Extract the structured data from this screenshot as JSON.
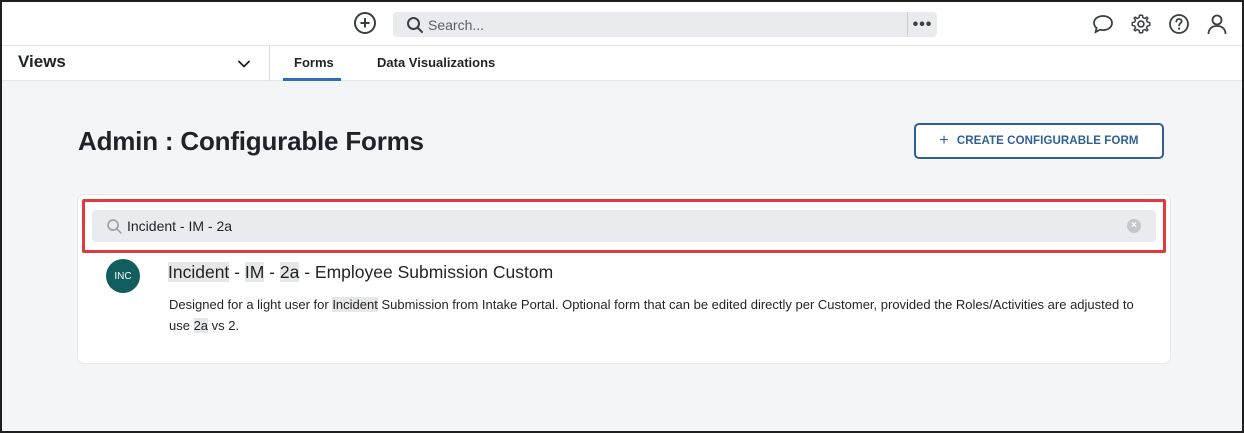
{
  "topbar": {
    "search_placeholder": "Search...",
    "more_label": "•••"
  },
  "subnav": {
    "views_label": "Views",
    "tabs": [
      {
        "label": "Forms"
      },
      {
        "label": "Data Visualizations"
      }
    ]
  },
  "page": {
    "title": "Admin : Configurable Forms",
    "create_button_label": "CREATE CONFIGURABLE FORM"
  },
  "form_search": {
    "value": "Incident - IM - 2a"
  },
  "result": {
    "avatar_text": "INC",
    "title_parts": {
      "p1": "Incident",
      "s1": " - ",
      "p2": "IM",
      "s2": " - ",
      "p3": "2a",
      "s3": " - ",
      "rest": "Employee Submission Custom"
    },
    "desc_parts": {
      "d1": "Designed for a light user for ",
      "d2": "Incident",
      "d3": " Submission from Intake Portal. Optional form that can be edited directly per Customer, provided the Roles/Activities are adjusted to use ",
      "d4": "2a",
      "d5": " vs 2."
    }
  },
  "colors": {
    "accent": "#2f6ebf",
    "button_border": "#2f5f95",
    "highlight_box": "#e0393e",
    "avatar_bg": "#125e5f"
  }
}
